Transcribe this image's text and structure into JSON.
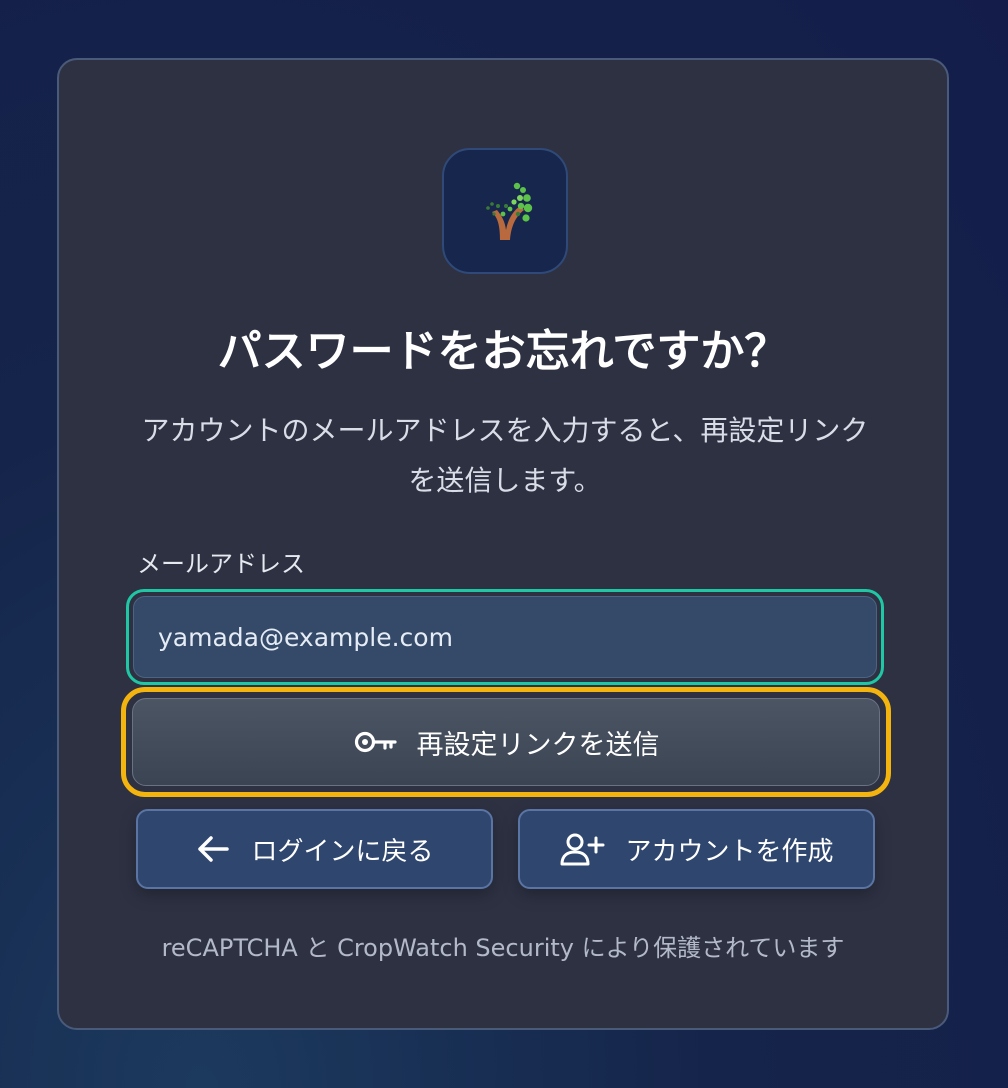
{
  "title": "パスワードをお忘れですか？",
  "subtitle": "アカウントのメールアドレスを入力すると、再設定リンクを送信します。",
  "email": {
    "label": "メールアドレス",
    "value": "yamada@example.com"
  },
  "primary_button": {
    "label": "再設定リンクを送信",
    "icon": "key-icon"
  },
  "back_button": {
    "label": "ログインに戻る",
    "icon": "arrow-left-icon"
  },
  "create_button": {
    "label": "アカウントを作成",
    "icon": "user-plus-icon"
  },
  "footer": "reCAPTCHA と CropWatch Security により保護されています",
  "colors": {
    "input_focus_ring": "#1fc7a4",
    "primary_focus_ring": "#f3b40f",
    "card_bg": "#2d3142"
  }
}
